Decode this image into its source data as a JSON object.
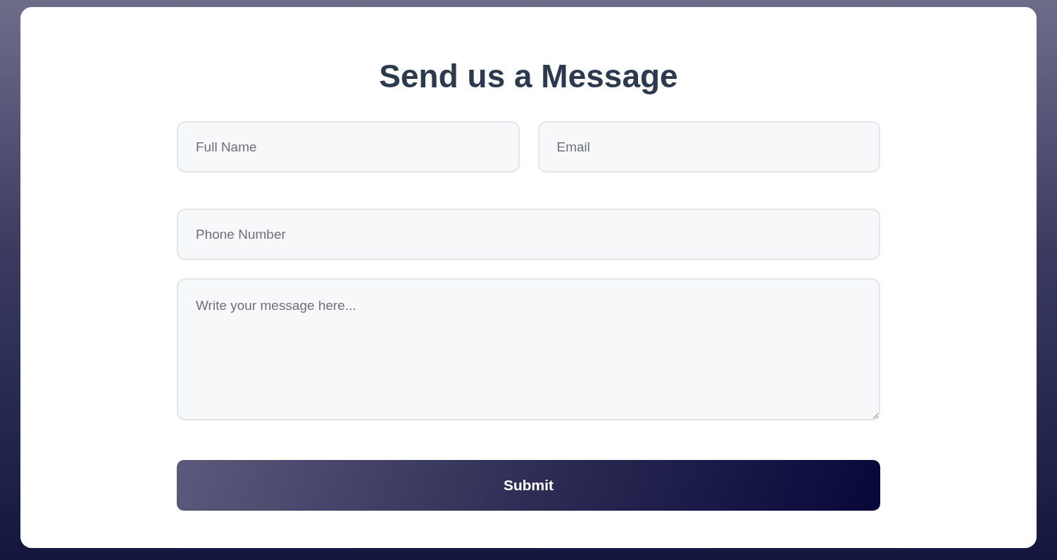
{
  "title": "Send us a Message",
  "fields": [
    {
      "placeholder": "Full Name"
    },
    {
      "placeholder": "Email"
    },
    {
      "placeholder": "Phone Number"
    }
  ],
  "message": {
    "placeholder": "Write your message here..."
  },
  "submit": {
    "label": "Submit"
  }
}
